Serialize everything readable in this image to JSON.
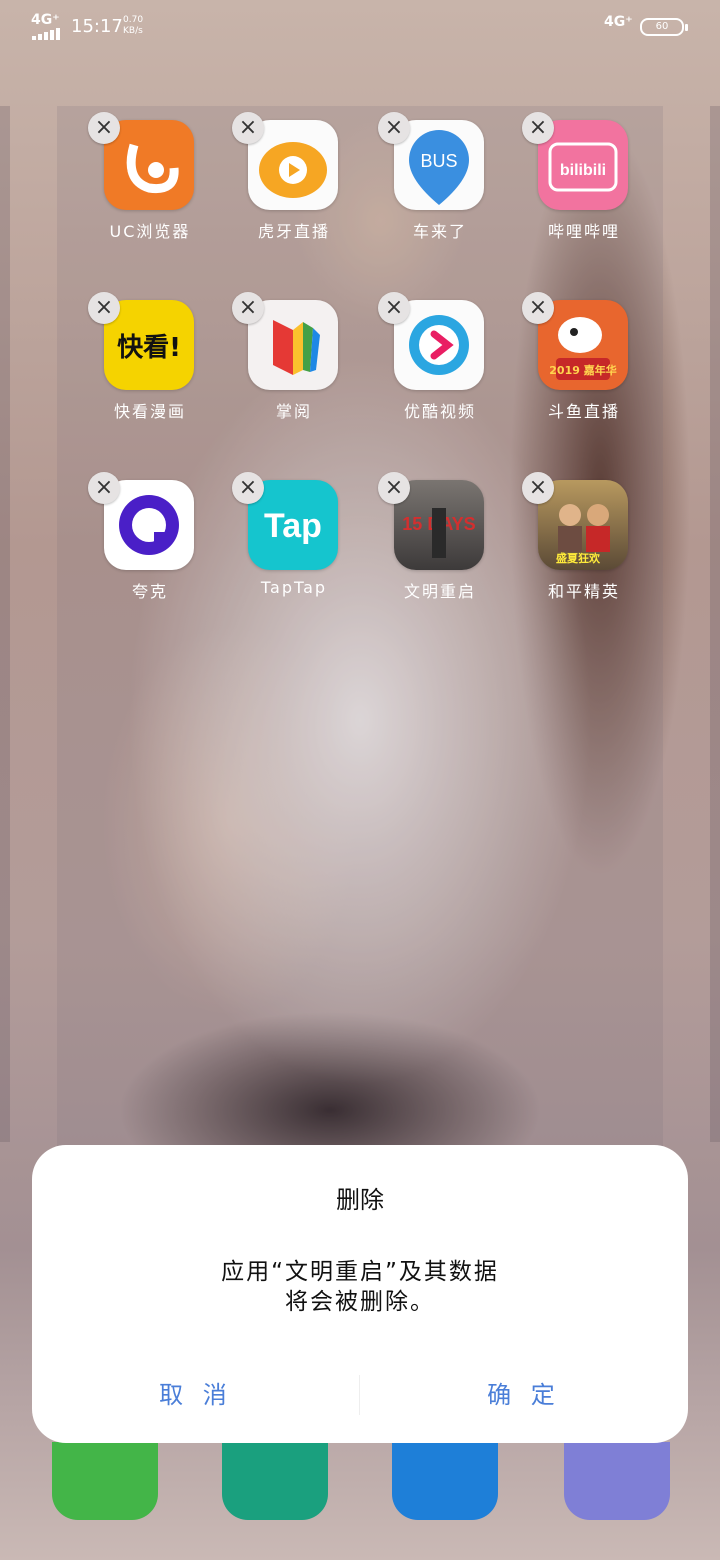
{
  "status_bar": {
    "signal_left": "4G⁺",
    "time": "15:17",
    "net_speed_value": "0.70",
    "net_speed_unit": "KB/s",
    "signal_right": "4G⁺",
    "battery": "60"
  },
  "folder": {
    "apps": [
      {
        "label": "UC浏览器",
        "icon": "uc-browser-icon",
        "color": "#f07a26"
      },
      {
        "label": "虎牙直播",
        "icon": "huya-icon",
        "color": "#f6a623"
      },
      {
        "label": "车来了",
        "icon": "bus-icon",
        "color": "#3a8fe0",
        "text": "BUS"
      },
      {
        "label": "哔哩哔哩",
        "icon": "bilibili-icon",
        "color": "#f2739f",
        "text": "bilibili"
      },
      {
        "label": "快看漫画",
        "icon": "kuaikan-icon",
        "color": "#f5d300",
        "text": "快看!"
      },
      {
        "label": "掌阅",
        "icon": "zhangyue-icon",
        "color": "#f4f1f1"
      },
      {
        "label": "优酷视频",
        "icon": "youku-icon",
        "color": "#2ba6e1"
      },
      {
        "label": "斗鱼直播",
        "icon": "douyu-icon",
        "color": "#e8662e",
        "text": "2019 嘉年华"
      },
      {
        "label": "夸克",
        "icon": "quark-icon",
        "color": "#ffffff"
      },
      {
        "label": "TapTap",
        "icon": "taptap-icon",
        "color": "#15c5ce",
        "text": "Tap"
      },
      {
        "label": "文明重启",
        "icon": "civilization-reboot-icon",
        "color": "#3d3a3a",
        "text": "15 DAYS"
      },
      {
        "label": "和平精英",
        "icon": "peacekeeper-elite-icon",
        "color": "#8e6c3c",
        "text": "盛夏狂欢"
      }
    ]
  },
  "dialog": {
    "title": "删除",
    "message_line1": "应用“文明重启”及其数据",
    "message_line2": "将会被删除。",
    "cancel_label": "取 消",
    "confirm_label": "确 定"
  },
  "dock": [
    "phone-icon",
    "contacts-icon",
    "messages-icon",
    "browser-icon"
  ]
}
